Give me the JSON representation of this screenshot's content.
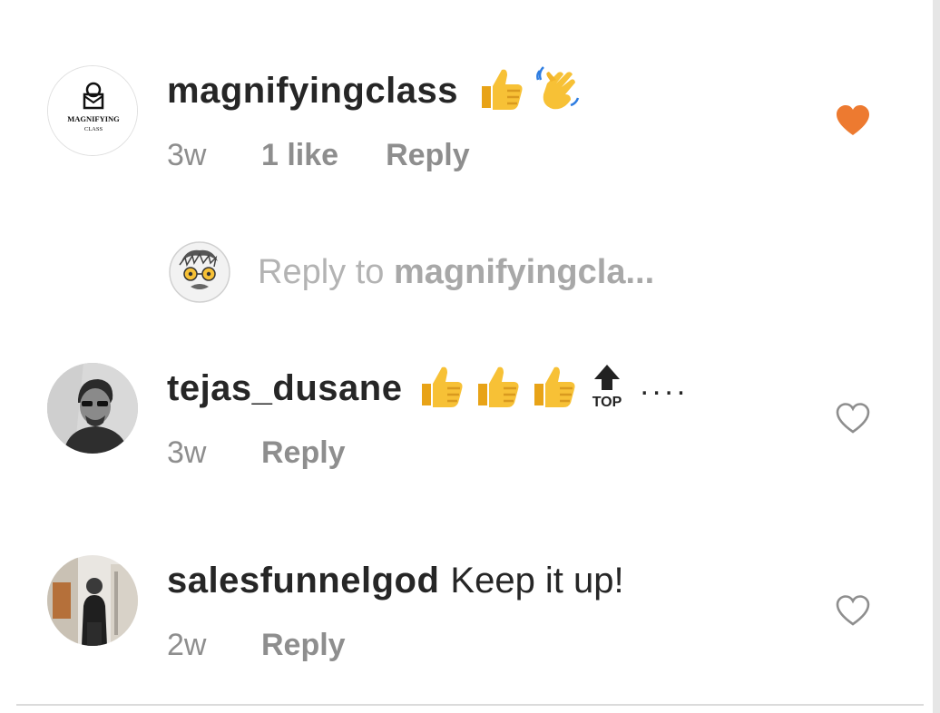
{
  "colors": {
    "text_primary": "#262626",
    "text_secondary": "#8e8e8e",
    "liked_heart": "#ed7a30",
    "unliked_heart": "#8e8e8e"
  },
  "comments": [
    {
      "username": "magnifyingclass",
      "text": "",
      "emojis": [
        "thumbs-up",
        "waving-hand"
      ],
      "time": "3w",
      "likes": "1 like",
      "reply_label": "Reply",
      "liked": true,
      "avatar_text_top": "MAGNIFYING",
      "avatar_text_bottom": "CLASS"
    },
    {
      "username": "tejas_dusane",
      "text": "",
      "emojis": [
        "thumbs-up",
        "thumbs-up",
        "thumbs-up",
        "top-arrow"
      ],
      "emoji_top_label": "TOP",
      "trailing": "....",
      "time": "3w",
      "reply_label": "Reply",
      "liked": false
    },
    {
      "username": "salesfunnelgod",
      "text": "Keep it up!",
      "time": "2w",
      "reply_label": "Reply",
      "liked": false
    }
  ],
  "reply_input": {
    "placeholder_prefix": "Reply to ",
    "placeholder_target": "magnifyingcla..."
  }
}
